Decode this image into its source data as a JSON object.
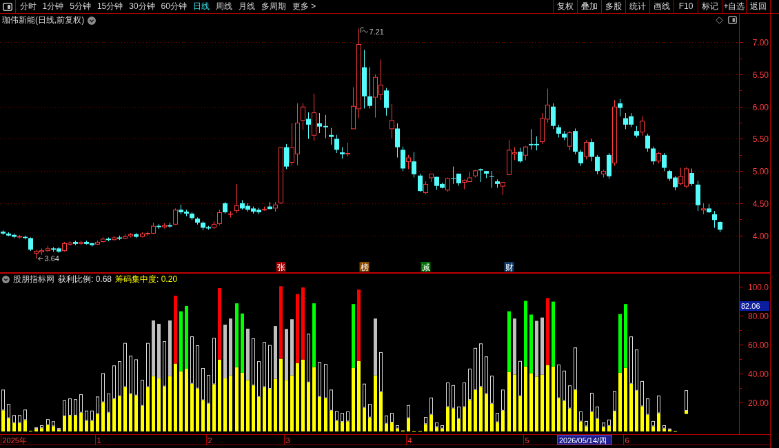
{
  "toolbar": {
    "period_tabs": [
      {
        "label": "分时",
        "selected": false
      },
      {
        "label": "1分钟",
        "selected": false
      },
      {
        "label": "5分钟",
        "selected": false
      },
      {
        "label": "15分钟",
        "selected": false
      },
      {
        "label": "30分钟",
        "selected": false
      },
      {
        "label": "60分钟",
        "selected": false
      },
      {
        "label": "日线",
        "selected": true
      },
      {
        "label": "周线",
        "selected": false
      },
      {
        "label": "月线",
        "selected": false
      },
      {
        "label": "多周期",
        "selected": false
      },
      {
        "label": "更多 >",
        "selected": false
      }
    ],
    "tool_buttons": [
      "复权",
      "叠加",
      "多股",
      "统计",
      "画线",
      "F10",
      "标记",
      "+自选",
      "返回"
    ]
  },
  "price_pane": {
    "title": "珈伟新能(日线,前复权)",
    "chart_data": [
      {
        "type": "candlestick",
        "ylim": [
          3.43,
          7.44
        ],
        "yticks": [
          {
            "value": 4,
            "label": "4.00"
          },
          {
            "value": 4.5,
            "label": "4.50"
          },
          {
            "value": 5,
            "label": "5.00"
          },
          {
            "value": 5.5,
            "label": "5.50"
          },
          {
            "value": 6,
            "label": "6.00"
          },
          {
            "value": 6.5,
            "label": "6.50"
          },
          {
            "value": 7,
            "label": "7.00"
          }
        ],
        "grid": true,
        "ohlc": [
          [
            4.06,
            4.08,
            4.01,
            4.03
          ],
          [
            4.03,
            4.05,
            3.99,
            4.0
          ],
          [
            4.01,
            4.03,
            3.96,
            3.98
          ],
          [
            3.97,
            4.01,
            3.95,
            3.99
          ],
          [
            3.98,
            4.0,
            3.94,
            3.96
          ],
          [
            3.96,
            3.97,
            3.76,
            3.78
          ],
          [
            3.72,
            3.78,
            3.64,
            3.76
          ],
          [
            3.74,
            3.8,
            3.7,
            3.77
          ],
          [
            3.76,
            3.84,
            3.74,
            3.8
          ],
          [
            3.8,
            3.82,
            3.75,
            3.78
          ],
          [
            3.8,
            3.82,
            3.73,
            3.75
          ],
          [
            3.76,
            3.9,
            3.75,
            3.88
          ],
          [
            3.86,
            3.91,
            3.84,
            3.89
          ],
          [
            3.9,
            3.92,
            3.85,
            3.87
          ],
          [
            3.87,
            3.92,
            3.85,
            3.9
          ],
          [
            3.9,
            3.92,
            3.86,
            3.87
          ],
          [
            3.88,
            3.89,
            3.83,
            3.85
          ],
          [
            3.86,
            3.92,
            3.85,
            3.9
          ],
          [
            3.9,
            3.97,
            3.89,
            3.95
          ],
          [
            3.95,
            3.97,
            3.91,
            3.93
          ],
          [
            3.93,
            3.99,
            3.92,
            3.97
          ],
          [
            3.97,
            4.0,
            3.93,
            3.95
          ],
          [
            3.95,
            4.02,
            3.94,
            3.99
          ],
          [
            3.99,
            4.04,
            3.97,
            4.02
          ],
          [
            4.02,
            4.04,
            3.96,
            3.98
          ],
          [
            3.98,
            4.05,
            3.97,
            4.03
          ],
          [
            4.02,
            4.06,
            4.0,
            4.04
          ],
          [
            4.03,
            4.2,
            4.02,
            4.15
          ],
          [
            4.15,
            4.18,
            4.1,
            4.13
          ],
          [
            4.13,
            4.19,
            4.11,
            4.16
          ],
          [
            4.16,
            4.2,
            4.12,
            4.14
          ],
          [
            4.17,
            4.42,
            4.16,
            4.4
          ],
          [
            4.4,
            4.48,
            4.33,
            4.36
          ],
          [
            4.37,
            4.4,
            4.3,
            4.34
          ],
          [
            4.34,
            4.36,
            4.24,
            4.27
          ],
          [
            4.26,
            4.28,
            4.17,
            4.2
          ],
          [
            4.2,
            4.22,
            4.08,
            4.12
          ],
          [
            4.13,
            4.15,
            4.09,
            4.11
          ],
          [
            4.12,
            4.22,
            4.1,
            4.18
          ],
          [
            4.18,
            4.4,
            4.16,
            4.36
          ],
          [
            4.5,
            4.52,
            4.34,
            4.36
          ],
          [
            4.33,
            4.38,
            4.28,
            4.34
          ],
          [
            4.38,
            4.8,
            4.35,
            4.47
          ],
          [
            4.5,
            4.55,
            4.4,
            4.42
          ],
          [
            4.46,
            4.5,
            4.37,
            4.4
          ],
          [
            4.42,
            4.45,
            4.34,
            4.37
          ],
          [
            4.4,
            4.43,
            4.33,
            4.36
          ],
          [
            4.39,
            4.45,
            4.38,
            4.41
          ],
          [
            4.45,
            4.52,
            4.41,
            4.41
          ],
          [
            4.42,
            4.52,
            4.37,
            4.48
          ],
          [
            4.5,
            5.37,
            4.49,
            5.37
          ],
          [
            5.37,
            5.42,
            5.03,
            5.07
          ],
          [
            5.13,
            5.74,
            5.09,
            5.37
          ],
          [
            5.26,
            6.05,
            5.09,
            5.75
          ],
          [
            5.78,
            6.05,
            5.64,
            6.0
          ],
          [
            5.81,
            5.91,
            5.5,
            5.72
          ],
          [
            5.55,
            6.2,
            5.47,
            5.91
          ],
          [
            5.74,
            5.9,
            5.59,
            5.69
          ],
          [
            5.7,
            5.87,
            5.51,
            5.68
          ],
          [
            5.56,
            5.67,
            5.41,
            5.53
          ],
          [
            5.5,
            5.56,
            5.28,
            5.33
          ],
          [
            5.29,
            5.37,
            5.19,
            5.26
          ],
          [
            5.26,
            5.44,
            5.23,
            5.28
          ],
          [
            5.65,
            6.3,
            5.65,
            6.01
          ],
          [
            5.96,
            7.21,
            5.82,
            6.97
          ],
          [
            6.61,
            6.88,
            5.97,
            6.16
          ],
          [
            6.16,
            6.61,
            5.97,
            6.01
          ],
          [
            6.14,
            6.5,
            5.83,
            6.46
          ],
          [
            6.18,
            6.73,
            6.1,
            6.34
          ],
          [
            6.25,
            6.29,
            5.86,
            5.98
          ],
          [
            5.65,
            6.04,
            5.51,
            5.79
          ],
          [
            5.66,
            5.74,
            5.21,
            5.37
          ],
          [
            5.33,
            5.38,
            5.0,
            5.04
          ],
          [
            5.14,
            5.25,
            5.03,
            5.21
          ],
          [
            5.15,
            5.29,
            4.9,
            4.95
          ],
          [
            4.93,
            4.96,
            4.68,
            4.69
          ],
          [
            4.66,
            4.84,
            4.64,
            4.8
          ],
          [
            4.89,
            4.96,
            4.83,
            4.96
          ],
          [
            4.91,
            4.91,
            4.71,
            4.77
          ],
          [
            4.8,
            4.82,
            4.73,
            4.74
          ],
          [
            4.7,
            4.9,
            4.68,
            4.89
          ],
          [
            4.89,
            5.07,
            4.8,
            4.88
          ],
          [
            4.96,
            4.96,
            4.77,
            4.81
          ],
          [
            4.82,
            4.87,
            4.72,
            4.86
          ],
          [
            4.83,
            4.99,
            4.83,
            4.9
          ],
          [
            4.92,
            5.02,
            4.9,
            5.01
          ],
          [
            5.03,
            5.04,
            4.83,
            5.01
          ],
          [
            5.0,
            5.0,
            4.89,
            4.96
          ],
          [
            4.92,
            5.0,
            4.74,
            4.91
          ],
          [
            4.84,
            4.87,
            4.74,
            4.8
          ],
          [
            4.76,
            4.83,
            4.63,
            4.83
          ],
          [
            4.94,
            5.48,
            4.94,
            5.33
          ],
          [
            5.26,
            5.37,
            5.17,
            5.29
          ],
          [
            5.3,
            5.36,
            5.13,
            5.15
          ],
          [
            5.24,
            5.39,
            5.17,
            5.38
          ],
          [
            5.42,
            5.65,
            5.33,
            5.4
          ],
          [
            5.42,
            5.54,
            5.32,
            5.4
          ],
          [
            5.45,
            5.9,
            5.42,
            5.82
          ],
          [
            5.8,
            6.28,
            5.75,
            6.03
          ],
          [
            6.0,
            6.05,
            5.65,
            5.7
          ],
          [
            5.68,
            5.72,
            5.52,
            5.58
          ],
          [
            5.58,
            5.62,
            5.48,
            5.52
          ],
          [
            5.38,
            5.62,
            5.32,
            5.6
          ],
          [
            5.62,
            5.66,
            5.26,
            5.3
          ],
          [
            5.3,
            5.33,
            5.08,
            5.12
          ],
          [
            5.22,
            5.48,
            5.18,
            5.45
          ],
          [
            5.45,
            5.5,
            5.15,
            5.22
          ],
          [
            5.22,
            5.25,
            4.95,
            5.0
          ],
          [
            4.95,
            5.02,
            4.9,
            5.0
          ],
          [
            5.25,
            5.28,
            4.88,
            4.92
          ],
          [
            5.12,
            6.1,
            5.08,
            6.0
          ],
          [
            6.05,
            6.12,
            5.85,
            5.98
          ],
          [
            5.82,
            5.9,
            5.65,
            5.72
          ],
          [
            5.85,
            5.9,
            5.68,
            5.72
          ],
          [
            5.62,
            5.7,
            5.52,
            5.55
          ],
          [
            5.6,
            5.85,
            5.55,
            5.78
          ],
          [
            5.55,
            5.58,
            5.3,
            5.35
          ],
          [
            5.35,
            5.38,
            5.1,
            5.15
          ],
          [
            5.15,
            5.3,
            5.12,
            5.28
          ],
          [
            5.25,
            5.28,
            5.0,
            5.05
          ],
          [
            5.0,
            5.02,
            4.85,
            4.88
          ],
          [
            4.9,
            4.92,
            4.7,
            4.75
          ],
          [
            4.8,
            5.05,
            4.78,
            4.92
          ],
          [
            4.76,
            5.06,
            4.74,
            5.04
          ],
          [
            4.97,
            5.04,
            4.77,
            4.8
          ],
          [
            4.79,
            4.85,
            4.38,
            4.47
          ],
          [
            4.39,
            4.5,
            4.33,
            4.42
          ],
          [
            4.42,
            4.49,
            4.35,
            4.36
          ],
          [
            4.33,
            4.38,
            4.12,
            4.24
          ],
          [
            4.21,
            4.22,
            4.05,
            4.09
          ],
          null,
          null,
          null
        ],
        "annotations": [
          "7.21",
          "3.64"
        ]
      }
    ],
    "event_markers": [
      {
        "label": "张",
        "color": "#a00000"
      },
      {
        "label": "榜",
        "color": "#8a4a00"
      },
      {
        "label": "减",
        "color": "#007000"
      },
      {
        "label": "财",
        "color": "#103a6a"
      }
    ]
  },
  "indicator_pane": {
    "name": "股朋指标网",
    "readouts": [
      {
        "text": "获利比例: 0.68",
        "color": "#e6e6e6"
      },
      {
        "text": "筹码集中度: 0.20",
        "color": "#ffff00"
      }
    ],
    "cursor": {
      "date": "2026/05/14/四",
      "value": "82.06"
    },
    "time_axis": [
      "2025年",
      "1",
      "2",
      "3",
      "4",
      "5",
      "6"
    ],
    "chart_data": [
      {
        "type": "bar",
        "stacked": true,
        "ylim": [
          -1.9,
          109.5
        ],
        "yticks": [
          {
            "value": 20,
            "label": "20.00"
          },
          {
            "value": 40,
            "label": "40.00"
          },
          {
            "value": 60,
            "label": "60.00"
          },
          {
            "value": 80,
            "label": "80.00"
          },
          {
            "value": 100,
            "label": "100.0"
          }
        ],
        "series": [
          {
            "color": "#ffff00",
            "base": [
              null,
              null,
              null,
              null,
              null,
              null,
              null,
              null,
              null,
              null,
              null,
              null,
              null,
              null,
              null,
              null,
              null,
              null,
              null,
              null,
              null,
              null,
              null,
              null,
              null,
              null,
              null,
              null,
              null,
              null,
              null,
              null,
              null,
              null,
              null,
              null,
              null,
              null,
              null,
              null,
              null,
              null,
              null,
              null,
              null,
              null,
              null,
              null,
              null,
              null,
              null,
              null,
              null,
              null,
              null,
              null,
              null,
              null,
              null,
              null,
              null,
              null,
              null,
              null,
              null,
              null,
              null,
              null,
              null,
              null,
              null,
              null,
              null,
              null,
              null,
              null,
              null,
              null,
              null,
              null,
              null,
              null,
              null,
              null,
              null,
              null,
              null,
              null,
              null,
              null,
              null,
              null,
              null,
              null,
              null,
              null,
              null,
              null,
              null,
              null,
              null,
              null,
              null,
              null,
              null,
              null,
              null,
              null,
              null,
              null,
              null,
              null,
              null,
              null,
              null,
              null,
              null,
              null,
              null,
              null,
              null,
              null,
              null,
              12.1,
              null,
              null,
              null,
              null,
              null,
              null,
              null,
              null,
              null
            ],
            "values": [
              14.6,
              9.2,
              5.9,
              5.9,
              7.9,
              0.5,
              1.8,
              2.3,
              4.4,
              3.6,
              1.3,
              10.5,
              11.0,
              11.0,
              13.0,
              7.4,
              7.4,
              12.1,
              20.2,
              13.0,
              22.5,
              24.4,
              30.7,
              25.9,
              24.9,
              17.7,
              30.7,
              38.2,
              36.7,
              31.1,
              38.2,
              46.9,
              41.6,
              43.3,
              33.0,
              29.7,
              21.6,
              19.2,
              32.6,
              49.7,
              36.7,
              38.7,
              44.4,
              40.5,
              35.4,
              31.8,
              23.9,
              30.7,
              29.5,
              36.4,
              50.2,
              35.6,
              38.7,
              47.2,
              49.7,
              33.9,
              44.4,
              23.9,
              23.0,
              14.4,
              7.4,
              6.6,
              7.0,
              43.8,
              48.7,
              16.4,
              9.7,
              38.7,
              27.2,
              5.4,
              6.2,
              2.1,
              0.7,
              9.2,
              0.3,
              0.3,
              5.1,
              11.6,
              3.1,
              2.1,
              16.9,
              15.9,
              8.7,
              16.9,
              21.8,
              28.7,
              30.8,
              25.9,
              19.2,
              6.4,
              14.4,
              41.1,
              39.3,
              24.4,
              44.9,
              40.3,
              37.9,
              39.2,
              45.9,
              44.9,
              23.0,
              21.1,
              15.9,
              28.7,
              6.9,
              3.6,
              13.4,
              8.7,
              3.0,
              3.9,
              13.9,
              40.5,
              43.9,
              33.0,
              28.2,
              17.4,
              11.6,
              3.6,
              12.6,
              2.1,
              1.1,
              0.3,
              null,
              2.2,
              null,
              null,
              null,
              null,
              null,
              null,
              null,
              null,
              null
            ]
          },
          {
            "color": "#dcdcdc",
            "values": [
              14.3,
              9.8,
              5.4,
              5.4,
              7.2,
              null,
              1.0,
              2.0,
              4.1,
              3.4,
              1.0,
              11.0,
              11.8,
              11.3,
              12.7,
              7.0,
              7.0,
              12.0,
              20.1,
              13.2,
              23.1,
              24.1,
              30.4,
              26.4,
              24.9,
              17.9,
              30.4,
              null,
              null,
              31.2,
              null,
              null,
              null,
              null,
              32.7,
              29.8,
              22.2,
              19.8,
              32.0,
              null,
              null,
              null,
              null,
              null,
              null,
              32.5,
              24.6,
              31.1,
              30.2,
              null,
              null,
              null,
              null,
              null,
              null,
              33.6,
              null,
              24.1,
              23.6,
              14.5,
              6.7,
              6.2,
              6.8,
              null,
              null,
              16.6,
              9.3,
              null,
              27.6,
              5.6,
              6.6,
              2.2,
              null,
              9.0,
              null,
              null,
              4.9,
              11.8,
              3.1,
              2.2,
              16.9,
              16.1,
              8.5,
              16.9,
              21.6,
              29.0,
              30.0,
              25.9,
              19.3,
              6.4,
              14.5,
              null,
              null,
              24.3,
              null,
              null,
              null,
              null,
              null,
              null,
              23.2,
              20.9,
              15.9,
              29.3,
              6.9,
              3.6,
              13.3,
              8.5,
              3.1,
              4.3,
              14.1,
              null,
              null,
              32.6,
              28.4,
              17.4,
              11.2,
              3.6,
              12.2,
              2.2,
              0.9,
              null,
              null,
              14.2,
              null,
              null,
              null,
              null,
              null,
              null,
              null,
              null,
              null
            ]
          },
          {
            "color": "#c0c0c0",
            "values": [
              null,
              null,
              null,
              null,
              null,
              null,
              null,
              null,
              null,
              null,
              null,
              null,
              null,
              null,
              null,
              null,
              null,
              null,
              null,
              null,
              null,
              null,
              null,
              null,
              null,
              null,
              null,
              38.5,
              37.6,
              null,
              38.5,
              null,
              null,
              null,
              null,
              null,
              null,
              null,
              null,
              null,
              37.1,
              39.3,
              null,
              null,
              35.6,
              null,
              null,
              null,
              null,
              36.4,
              null,
              35.2,
              38.8,
              null,
              null,
              null,
              null,
              null,
              null,
              null,
              null,
              null,
              null,
              null,
              null,
              null,
              null,
              39.3,
              null,
              null,
              null,
              null,
              null,
              null,
              null,
              null,
              null,
              null,
              null,
              null,
              null,
              null,
              null,
              null,
              null,
              null,
              null,
              null,
              null,
              null,
              null,
              null,
              38.7,
              null,
              null,
              null,
              38.5,
              39.5,
              null,
              null,
              null,
              null,
              null,
              null,
              null,
              null,
              null,
              null,
              null,
              null,
              null,
              null,
              null,
              null,
              null,
              null,
              null,
              null,
              null,
              null,
              null,
              null,
              null,
              null,
              null,
              null,
              null,
              null,
              null,
              null,
              null,
              null,
              null
            ]
          },
          {
            "color": "#ff0000",
            "values": [
              null,
              null,
              null,
              null,
              null,
              null,
              null,
              null,
              null,
              null,
              null,
              null,
              null,
              null,
              null,
              null,
              null,
              null,
              null,
              null,
              null,
              null,
              null,
              null,
              null,
              null,
              null,
              null,
              null,
              null,
              null,
              46.9,
              null,
              null,
              null,
              null,
              null,
              null,
              null,
              49.3,
              null,
              null,
              null,
              null,
              null,
              null,
              null,
              null,
              null,
              null,
              50.1,
              null,
              null,
              47.7,
              49.8,
              null,
              null,
              null,
              null,
              null,
              null,
              null,
              null,
              null,
              49.3,
              null,
              null,
              null,
              null,
              null,
              null,
              null,
              null,
              null,
              null,
              null,
              null,
              null,
              null,
              null,
              null,
              null,
              null,
              null,
              null,
              null,
              null,
              null,
              null,
              null,
              null,
              null,
              null,
              null,
              null,
              null,
              null,
              null,
              46.2,
              null,
              null,
              null,
              null,
              null,
              null,
              null,
              null,
              null,
              null,
              null,
              null,
              null,
              null,
              null,
              null,
              null,
              null,
              null,
              null,
              null,
              null,
              null,
              null,
              null,
              null,
              null,
              null,
              null,
              null,
              null,
              null,
              null,
              null
            ]
          },
          {
            "color": "#00ff00",
            "values": [
              null,
              null,
              null,
              null,
              null,
              null,
              null,
              null,
              null,
              null,
              null,
              null,
              null,
              null,
              null,
              null,
              null,
              null,
              null,
              null,
              null,
              null,
              null,
              null,
              null,
              null,
              null,
              null,
              null,
              null,
              null,
              null,
              41.4,
              43.4,
              null,
              null,
              null,
              null,
              null,
              null,
              null,
              null,
              44.1,
              41.0,
              null,
              null,
              null,
              null,
              null,
              null,
              null,
              null,
              null,
              null,
              null,
              null,
              44.1,
              null,
              null,
              null,
              null,
              null,
              null,
              44.2,
              null,
              null,
              null,
              null,
              null,
              null,
              null,
              null,
              null,
              null,
              null,
              null,
              null,
              null,
              null,
              null,
              null,
              null,
              null,
              null,
              null,
              null,
              null,
              null,
              null,
              null,
              null,
              41.9,
              null,
              null,
              45.3,
              40.4,
              null,
              null,
              null,
              44.8,
              null,
              null,
              null,
              null,
              null,
              null,
              null,
              null,
              null,
              null,
              null,
              40.6,
              44.1,
              null,
              null,
              null,
              null,
              null,
              null,
              null,
              null,
              null,
              null,
              null,
              null,
              null,
              null,
              null,
              null,
              null,
              null,
              null,
              null
            ]
          }
        ]
      }
    ]
  }
}
